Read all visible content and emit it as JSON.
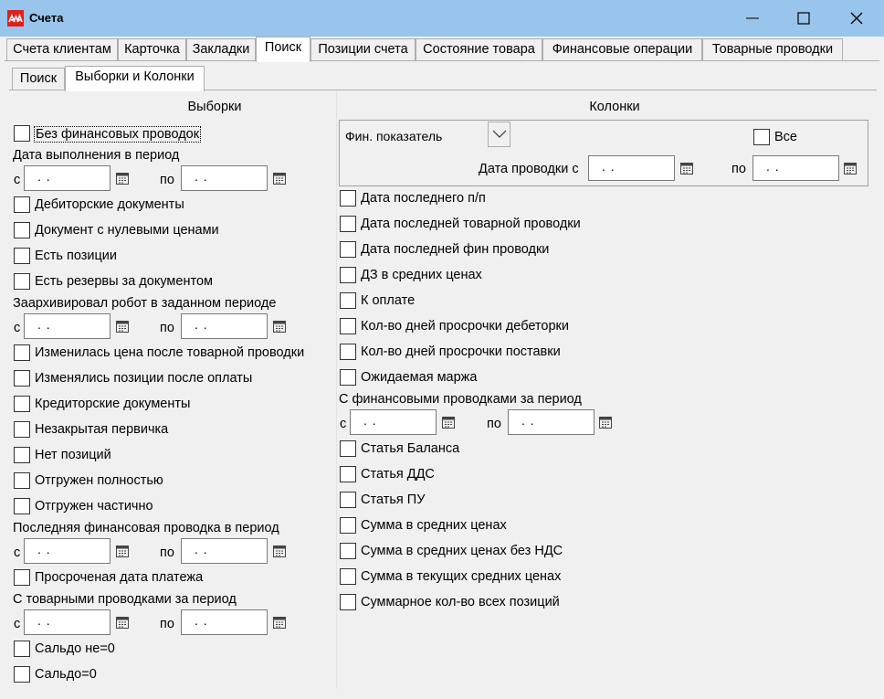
{
  "window": {
    "title": "Счета"
  },
  "tabs": [
    "Счета клиентам",
    "Карточка",
    "Закладки",
    "Поиск",
    "Позиции счета",
    "Состояние товара",
    "Финансовые операции",
    "Товарные проводки"
  ],
  "subtabs": [
    "Поиск",
    "Выборки и Колонки"
  ],
  "left": {
    "header": "Выборки",
    "no_fin": "Без финансовых проводок",
    "exec_period": "Дата выполнения в период",
    "debitor": "Дебиторские документы",
    "zero_price": "Документ с нулевыми ценами",
    "has_positions": "Есть позиции",
    "has_reserves": "Есть резервы за документом",
    "archived_period": "Заархивировал робот в заданном периоде",
    "price_changed": "Изменилась цена после товарной проводки",
    "positions_changed": "Изменялись позиции после оплаты",
    "creditor": "Кредиторские документы",
    "unclosed_primary": "Незакрытая первичка",
    "no_positions": "Нет позиций",
    "shipped_full": "Отгружен полностью",
    "shipped_partial": "Отгружен частично",
    "last_fin_period": "Последняя финансовая проводка в период",
    "overdue_payment": "Просроченая дата платежа",
    "goods_period": "С товарными проводками за период",
    "saldo_nonzero": "Сальдо не=0",
    "saldo_zero": "Сальдо=0"
  },
  "right": {
    "header": "Колонки",
    "fin_indicator": "Фин. показатель",
    "all": "Все",
    "post_date_from": "Дата проводки с",
    "last_pp": "Дата последнего п/п",
    "last_goods": "Дата последней товарной проводки",
    "last_fin": "Дата последней фин проводки",
    "dz_avg": "ДЗ в средних ценах",
    "to_pay": "К оплате",
    "days_overdue_deb": "Кол-во дней просрочки дебеторки",
    "days_overdue_supply": "Кол-во дней просрочки поставки",
    "expected_margin": "Ожидаемая маржа",
    "fin_period": "С финансовыми проводками за период",
    "balance_item": "Статья Баланса",
    "dds_item": "Статья ДДС",
    "pu_item": "Статья ПУ",
    "sum_avg": "Сумма в средних ценах",
    "sum_avg_no_vat": "Сумма в средних ценах без НДС",
    "sum_current_avg": "Сумма в текущих средних ценах",
    "total_qty": "Суммарное кол-во всех позиций"
  },
  "labels": {
    "from": "с",
    "to": "по"
  },
  "date_empty": ". .",
  "colors": {
    "titlebar": "#99c4ec",
    "logo": "#e0201c",
    "background": "#f0f0f0",
    "border": "#adadad"
  }
}
